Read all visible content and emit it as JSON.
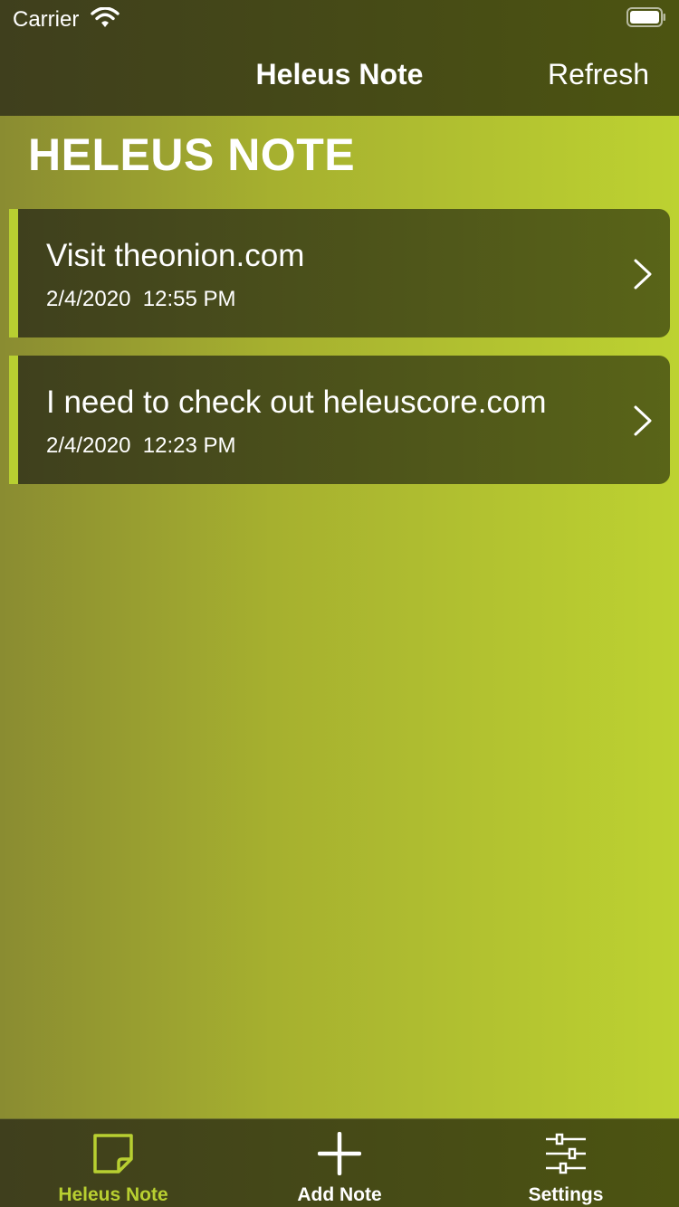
{
  "status_bar": {
    "carrier": "Carrier"
  },
  "nav": {
    "title": "Heleus Note",
    "refresh_label": "Refresh"
  },
  "large_title": "HELEUS NOTE",
  "notes": [
    {
      "title": "Visit theonion.com",
      "date": "2/4/2020  12:55 PM"
    },
    {
      "title": "I need to check out heleuscore.com",
      "date": "2/4/2020  12:23 PM"
    }
  ],
  "tabs": [
    {
      "label": "Heleus Note",
      "icon": "note-icon",
      "selected": true
    },
    {
      "label": "Add Note",
      "icon": "plus-icon",
      "selected": false
    },
    {
      "label": "Settings",
      "icon": "sliders-icon",
      "selected": false
    }
  ],
  "colors": {
    "accent": "#b8cf31",
    "bar_dark": "#3f3f1d",
    "background_light": "#bdd231"
  }
}
